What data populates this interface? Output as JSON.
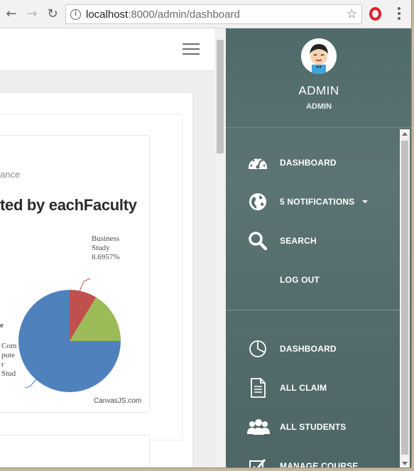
{
  "browser": {
    "url_host": "localhost",
    "url_path": ":8000/admin/dashboard"
  },
  "chart_data": {
    "type": "pie",
    "title": "ted by eachFaculty",
    "subtitle": "ance",
    "slices": [
      {
        "name": "Business Study",
        "label": "Business\nStudy\n8.6957%",
        "value": 8.6957,
        "color": "#c0504e"
      },
      {
        "name": "",
        "label": "",
        "value": 16.3,
        "color": "#9bbb59"
      },
      {
        "name": "Computer Stud",
        "label": "Com\npute\nr\nStud",
        "value": 75.0043,
        "color": "#4f81bc"
      }
    ],
    "edge_label": "e",
    "credit": "CanvasJS.com"
  },
  "sidebar": {
    "admin_name": "ADMIN",
    "admin_role": "ADMIN",
    "nav_top": [
      {
        "label": "DASHBOARD",
        "icon": "speedometer-icon"
      },
      {
        "label": "5 NOTIFICATIONS",
        "icon": "globe-icon"
      },
      {
        "label": "SEARCH",
        "icon": "search-icon"
      },
      {
        "label": "LOG OUT",
        "icon": ""
      }
    ],
    "nav_bottom": [
      {
        "label": "DASHBOARD",
        "icon": "pie-chart-icon"
      },
      {
        "label": "ALL CLAIM",
        "icon": "document-icon"
      },
      {
        "label": "ALL STUDENTS",
        "icon": "users-icon"
      },
      {
        "label": "MANAGE COURSE",
        "icon": "check-square-icon"
      }
    ]
  }
}
